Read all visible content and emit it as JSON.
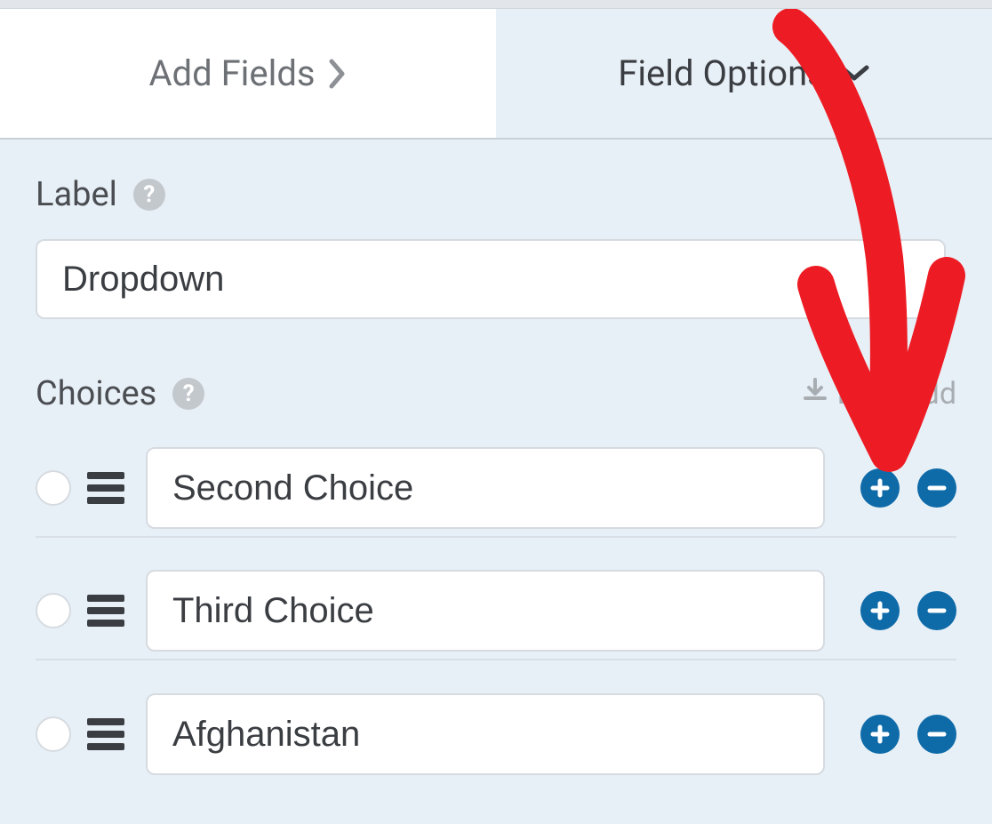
{
  "tabs": {
    "add_fields": "Add Fields",
    "field_options": "Field Options"
  },
  "label_section": {
    "title": "Label",
    "value": "Dropdown"
  },
  "choices_section": {
    "title": "Choices",
    "bulk_add": "Bulk Add",
    "items": [
      {
        "value": "Second Choice"
      },
      {
        "value": "Third Choice"
      },
      {
        "value": "Afghanistan"
      }
    ]
  },
  "colors": {
    "accent": "#0e6ba8",
    "annotation": "#ed1c24"
  }
}
